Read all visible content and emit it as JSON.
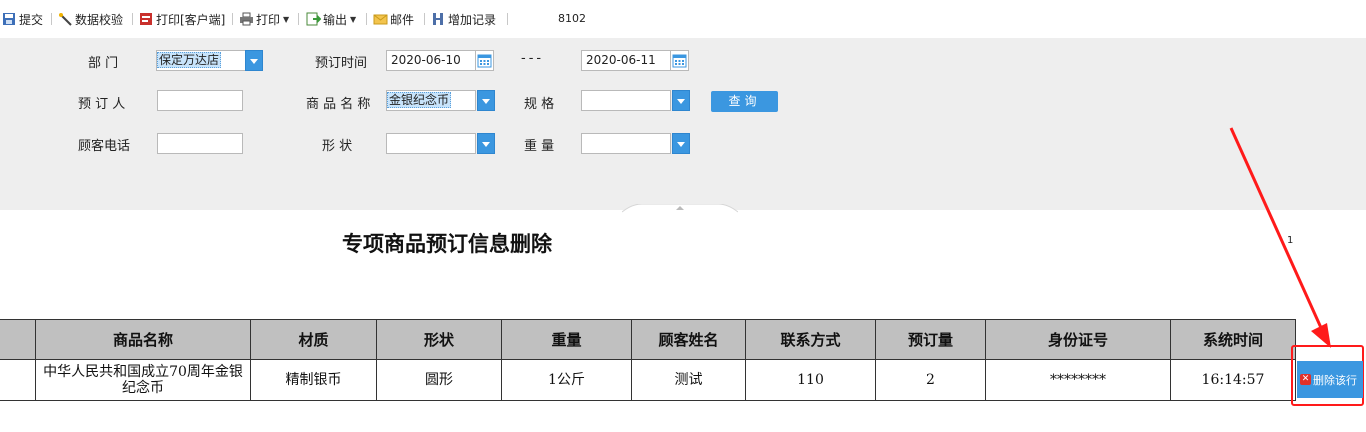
{
  "toolbar": {
    "submit": "提交",
    "validate": "数据校验",
    "print_client": "打印[客户端]",
    "print": "打印",
    "export": "输出",
    "mail": "邮件",
    "add_record": "增加记录",
    "code": "8102"
  },
  "form": {
    "dept_label": "部 门",
    "dept_value": "保定万达店",
    "order_time_label": "预订时间",
    "date_from": "2020-06-10",
    "dash": "---",
    "date_to": "2020-06-11",
    "orderer_label": "预 订 人",
    "orderer_value": "",
    "product_label": "商 品 名 称",
    "product_value": "金银纪念币",
    "spec_label": "规 格",
    "spec_value": "",
    "query_button": "查询",
    "phone_label": "顾客电话",
    "phone_value": "",
    "shape_label": "形 状",
    "shape_value": "",
    "weight_label": "重 量",
    "weight_value": ""
  },
  "report": {
    "title": "专项商品预订信息删除",
    "page": "1"
  },
  "table": {
    "headers": [
      "",
      "商品名称",
      "材质",
      "形状",
      "重量",
      "顾客姓名",
      "联系方式",
      "预订量",
      "身份证号",
      "系统时间"
    ],
    "rows": [
      [
        "",
        "中华人民共和国成立70周年金银纪念币",
        "精制银币",
        "圆形",
        "1公斤",
        "测试",
        "110",
        "2",
        "********",
        "16:14:57"
      ]
    ]
  },
  "actions": {
    "delete_row": "删除该行"
  },
  "colors": {
    "accent": "#3b97e0",
    "annotation": "#ff1a1a",
    "header_bg": "#c0c0c0",
    "panel_bg": "#eeeeee"
  }
}
